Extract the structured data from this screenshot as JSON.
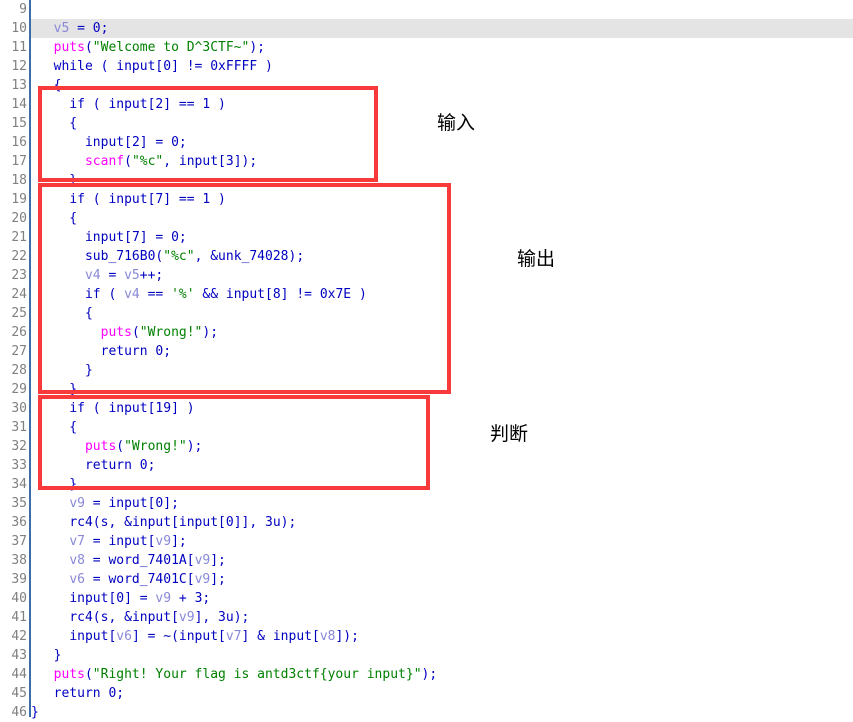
{
  "editor": {
    "name": "pseudocode-decompiler-view",
    "gutter_separator_color": "#3a6ea5",
    "highlight_color": "#e4e4e4",
    "highlighted_line": 10,
    "first_line_number": 9,
    "last_line_number": 46
  },
  "colors": {
    "keyword": "#0000c0",
    "string": "#008000",
    "library_function": "#ff00ff",
    "local_variable": "#8888d8",
    "line_number": "#808080",
    "annotation_box": "#f83a3a",
    "background": "#ffffff"
  },
  "lines": [
    {
      "n": 9,
      "text": ""
    },
    {
      "n": 10,
      "text": "  v5 = 0;"
    },
    {
      "n": 11,
      "text": "  puts(\"Welcome to D^3CTF~\");"
    },
    {
      "n": 12,
      "text": "  while ( input[0] != 0xFFFF )"
    },
    {
      "n": 13,
      "text": "  {"
    },
    {
      "n": 14,
      "text": "    if ( input[2] == 1 )"
    },
    {
      "n": 15,
      "text": "    {"
    },
    {
      "n": 16,
      "text": "      input[2] = 0;"
    },
    {
      "n": 17,
      "text": "      scanf(\"%c\", input[3]);"
    },
    {
      "n": 18,
      "text": "    }"
    },
    {
      "n": 19,
      "text": "    if ( input[7] == 1 )"
    },
    {
      "n": 20,
      "text": "    {"
    },
    {
      "n": 21,
      "text": "      input[7] = 0;"
    },
    {
      "n": 22,
      "text": "      sub_716B0(\"%c\", &unk_74028);"
    },
    {
      "n": 23,
      "text": "      v4 = v5++;"
    },
    {
      "n": 24,
      "text": "      if ( v4 == '%' && input[8] != 0x7E )"
    },
    {
      "n": 25,
      "text": "      {"
    },
    {
      "n": 26,
      "text": "        puts(\"Wrong!\");"
    },
    {
      "n": 27,
      "text": "        return 0;"
    },
    {
      "n": 28,
      "text": "      }"
    },
    {
      "n": 29,
      "text": "    }"
    },
    {
      "n": 30,
      "text": "    if ( input[19] )"
    },
    {
      "n": 31,
      "text": "    {"
    },
    {
      "n": 32,
      "text": "      puts(\"Wrong!\");"
    },
    {
      "n": 33,
      "text": "      return 0;"
    },
    {
      "n": 34,
      "text": "    }"
    },
    {
      "n": 35,
      "text": "    v9 = input[0];"
    },
    {
      "n": 36,
      "text": "    rc4(s, &input[input[0]], 3u);"
    },
    {
      "n": 37,
      "text": "    v7 = input[v9];"
    },
    {
      "n": 38,
      "text": "    v8 = word_7401A[v9];"
    },
    {
      "n": 39,
      "text": "    v6 = word_7401C[v9];"
    },
    {
      "n": 40,
      "text": "    input[0] = v9 + 3;"
    },
    {
      "n": 41,
      "text": "    rc4(s, &input[v9], 3u);"
    },
    {
      "n": 42,
      "text": "    input[v6] = ~(input[v7] & input[v8]);"
    },
    {
      "n": 43,
      "text": "  }"
    },
    {
      "n": 44,
      "text": "  puts(\"Right! Your flag is antd3ctf{your input}\");"
    },
    {
      "n": 45,
      "text": "  return 0;"
    },
    {
      "n": 46,
      "text": "}"
    }
  ],
  "annotations": [
    {
      "label": "输入",
      "name": "annotation-input"
    },
    {
      "label": "输出",
      "name": "annotation-output"
    },
    {
      "label": "判断",
      "name": "annotation-check"
    }
  ],
  "boxes": [
    {
      "name": "highlight-box-input",
      "covers_lines": "14-18"
    },
    {
      "name": "highlight-box-output",
      "covers_lines": "19-29"
    },
    {
      "name": "highlight-box-check",
      "covers_lines": "30-34"
    }
  ]
}
